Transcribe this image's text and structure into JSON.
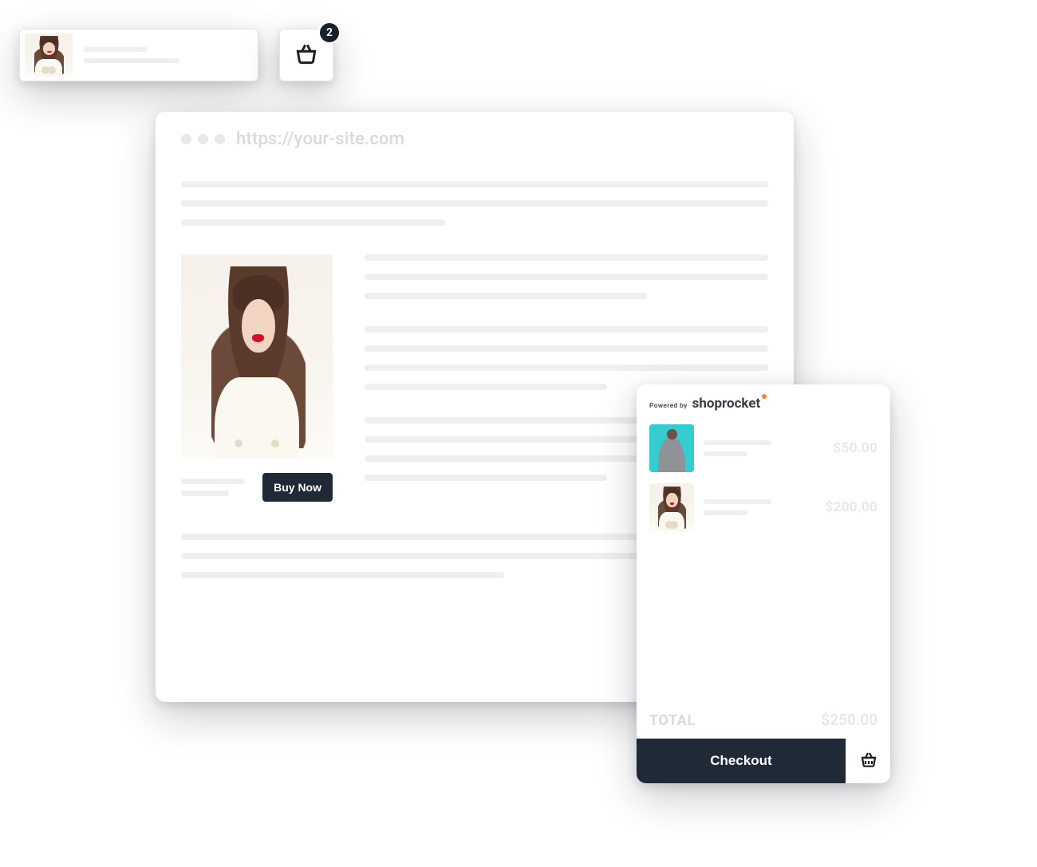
{
  "mini_widget": {
    "thumb_alt": "product-thumbnail"
  },
  "cart_button": {
    "badge_count": "2",
    "icon_name": "basket-icon"
  },
  "browser": {
    "url": "https://your-site.com",
    "product": {
      "buy_now_label": "Buy Now",
      "image_alt": "product-image"
    }
  },
  "cart_panel": {
    "powered_by_label": "Powered by",
    "brand": "shoprocket",
    "items": [
      {
        "price": "$50.00",
        "thumb_style": "teal"
      },
      {
        "price": "$200.00",
        "thumb_style": "cream"
      }
    ],
    "total_label": "TOTAL",
    "total_amount": "$250.00",
    "checkout_label": "Checkout"
  }
}
